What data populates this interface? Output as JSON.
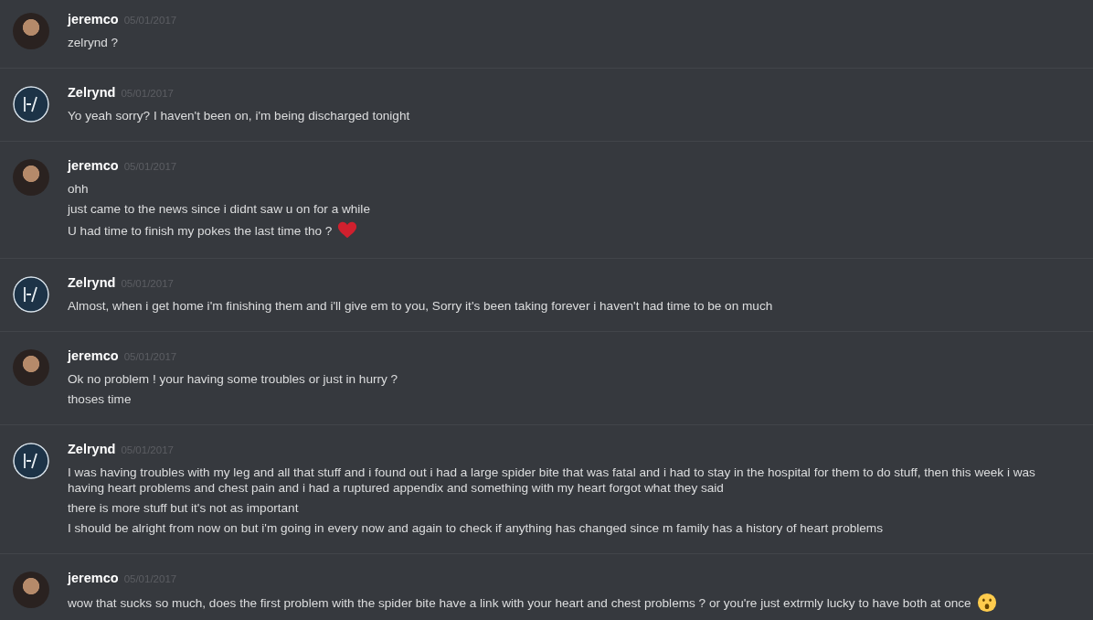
{
  "messages": [
    {
      "author": "jeremco",
      "avatar": {
        "kind": "photo"
      },
      "timestamp": "05/01/2017",
      "lines": [
        {
          "text": "zelrynd ?"
        }
      ]
    },
    {
      "author": "Zelrynd",
      "avatar": {
        "kind": "logo"
      },
      "timestamp": "05/01/2017",
      "lines": [
        {
          "text": "Yo yeah sorry? I haven't been on, i'm being discharged tonight"
        }
      ]
    },
    {
      "author": "jeremco",
      "avatar": {
        "kind": "photo"
      },
      "timestamp": "05/01/2017",
      "lines": [
        {
          "text": "ohh"
        },
        {
          "text": "just came to the news since i didnt saw u on for a while"
        },
        {
          "text": "U had time to finish my pokes the last time tho ?",
          "emoji": {
            "kind": "heart"
          }
        }
      ]
    },
    {
      "author": "Zelrynd",
      "avatar": {
        "kind": "logo"
      },
      "timestamp": "05/01/2017",
      "lines": [
        {
          "text": "Almost, when i get home i'm finishing them and i'll give em to you, Sorry it's been taking forever i haven't had time to be on much"
        }
      ]
    },
    {
      "author": "jeremco",
      "avatar": {
        "kind": "photo"
      },
      "timestamp": "05/01/2017",
      "lines": [
        {
          "text": "Ok no problem ! your having some troubles or just in hurry ?"
        },
        {
          "text": "thoses time"
        }
      ]
    },
    {
      "author": "Zelrynd",
      "avatar": {
        "kind": "logo"
      },
      "timestamp": "05/01/2017",
      "lines": [
        {
          "text": "I was having troubles with my leg and all that stuff and i found out i had a large spider bite that was fatal and i had to stay in the hospital for them to do stuff, then this week i was having heart problems and chest pain and i had a ruptured appendix and something with my heart forgot what they said"
        },
        {
          "text": "there is more stuff but it's not as important"
        },
        {
          "text": "I should be alright from now on but i'm going in every now and again to check if anything has changed since m family has a history of heart problems"
        }
      ]
    },
    {
      "author": "jeremco",
      "avatar": {
        "kind": "photo"
      },
      "timestamp": "05/01/2017",
      "lines": [
        {
          "text": "wow that sucks so much, does the first problem with the spider bite have a link with your heart and chest problems ? or you're just extrmly lucky to have both at once",
          "emoji": {
            "kind": "surprised"
          }
        }
      ]
    }
  ]
}
